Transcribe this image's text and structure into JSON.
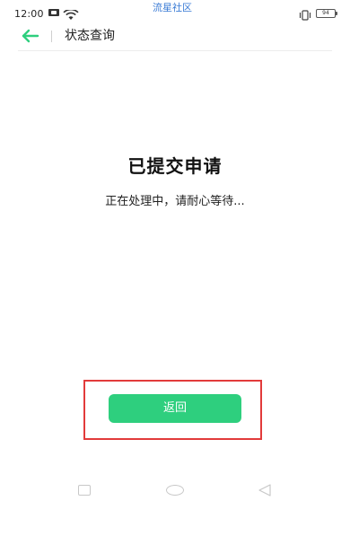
{
  "status_bar": {
    "time": "12:00",
    "watermark": "流星社区",
    "battery_level": "94",
    "icons": [
      "sim-icon",
      "wifi-icon",
      "vibrate-icon",
      "battery-icon"
    ]
  },
  "header": {
    "back_icon": "arrow-left-icon",
    "title": "状态查询"
  },
  "main": {
    "title": "已提交申请",
    "message": "正在处理中，请耐心等待..."
  },
  "actions": {
    "return_label": "返回"
  },
  "nav_bar": {
    "icons": [
      "recent-apps-icon",
      "home-icon",
      "back-icon"
    ]
  },
  "colors": {
    "accent": "#2ecf7e",
    "back_arrow": "#2ecf7e",
    "highlight": "#e23b3b",
    "watermark": "#3a7bd5"
  }
}
